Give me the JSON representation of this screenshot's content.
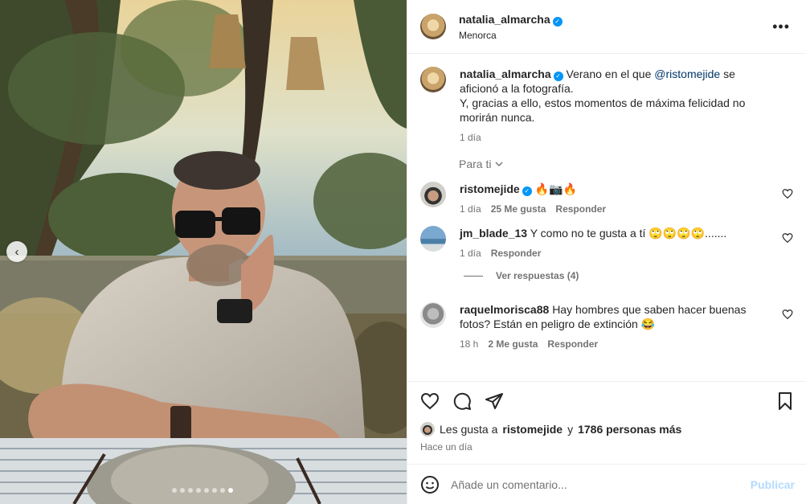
{
  "photo": {
    "alt": "",
    "dots_total": 8,
    "dots_active": 8,
    "prev_icon": "chevron-left-icon"
  },
  "post": {
    "author": "natalia_almarcha",
    "location": "Menorca",
    "more_icon": "more-horizontal-icon",
    "caption_prefix": "Verano en el que",
    "caption_mention": "@ristomejide",
    "caption_suffix": "se aficionó a la fotografía.",
    "caption_line2": "Y, gracias a ello, estos momentos de máxima felicidad no morirán nunca.",
    "caption_time": "1 día"
  },
  "for_you": "Para ti",
  "comments": [
    {
      "user": "ristomejide",
      "verified": true,
      "text": "🔥📷🔥",
      "time": "1 día",
      "likes": "25 Me gusta",
      "reply": "Responder"
    },
    {
      "user": "jm_blade_13",
      "verified": false,
      "text": "Y como no te gusta a tí 🙄🙄🙄🙄.......",
      "time": "1 día",
      "likes": "",
      "reply": "Responder"
    },
    {
      "user": "raquelmorisca88",
      "verified": false,
      "text": "Hay hombres que saben hacer buenas fotos? Están en peligro de extinción 😂",
      "time": "18 h",
      "likes": "2 Me gusta",
      "reply": "Responder"
    }
  ],
  "view_replies": "Ver respuestas (4)",
  "likes": {
    "prefix": "Les gusta a",
    "user": "ristomejide",
    "joiner": "y",
    "others": "1786 personas más"
  },
  "posted_ago": "Hace un día",
  "compose": {
    "placeholder": "Añade un comentario...",
    "publish": "Publicar",
    "emoji_icon": "smiley-icon"
  },
  "colors": {
    "accent": "#0095f6",
    "publish_disabled": "#b3dbff",
    "muted": "#737373"
  }
}
